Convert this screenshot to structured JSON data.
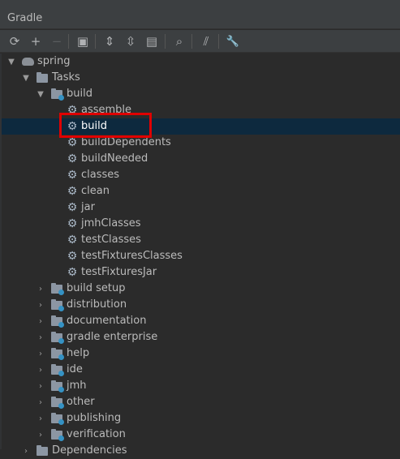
{
  "window": {
    "title": "Gradle"
  },
  "toolbar": {
    "buttons": [
      {
        "name": "refresh-icon",
        "glyph": "⟳"
      },
      {
        "name": "add-icon",
        "glyph": "+"
      },
      {
        "name": "remove-icon",
        "glyph": "−"
      },
      {
        "name": "run-task-icon",
        "glyph": "▣"
      },
      {
        "name": "expand-all-icon",
        "glyph": "⇕"
      },
      {
        "name": "collapse-all-icon",
        "glyph": "⇳"
      },
      {
        "name": "group-modules-icon",
        "glyph": "▤"
      },
      {
        "name": "analyze-dependencies-icon",
        "glyph": "⌕"
      },
      {
        "name": "toggle-offline-icon",
        "glyph": "⫽"
      },
      {
        "name": "settings-wrench-icon",
        "glyph": "🔧"
      }
    ]
  },
  "tree": {
    "project": "spring",
    "tasks": "Tasks",
    "build_group": "build",
    "build_tasks": [
      "assemble",
      "build",
      "buildDependents",
      "buildNeeded",
      "classes",
      "clean",
      "jar",
      "jmhClasses",
      "testClasses",
      "testFixturesClasses",
      "testFixturesJar"
    ],
    "selected_task": "build",
    "groups": [
      "build setup",
      "distribution",
      "documentation",
      "gradle enterprise",
      "help",
      "ide",
      "jmh",
      "other",
      "publishing",
      "verification"
    ],
    "next_node": "Dependencies"
  },
  "colors": {
    "background": "#2b2b2b",
    "selection": "#0d293e",
    "highlight_box": "#e00000"
  }
}
